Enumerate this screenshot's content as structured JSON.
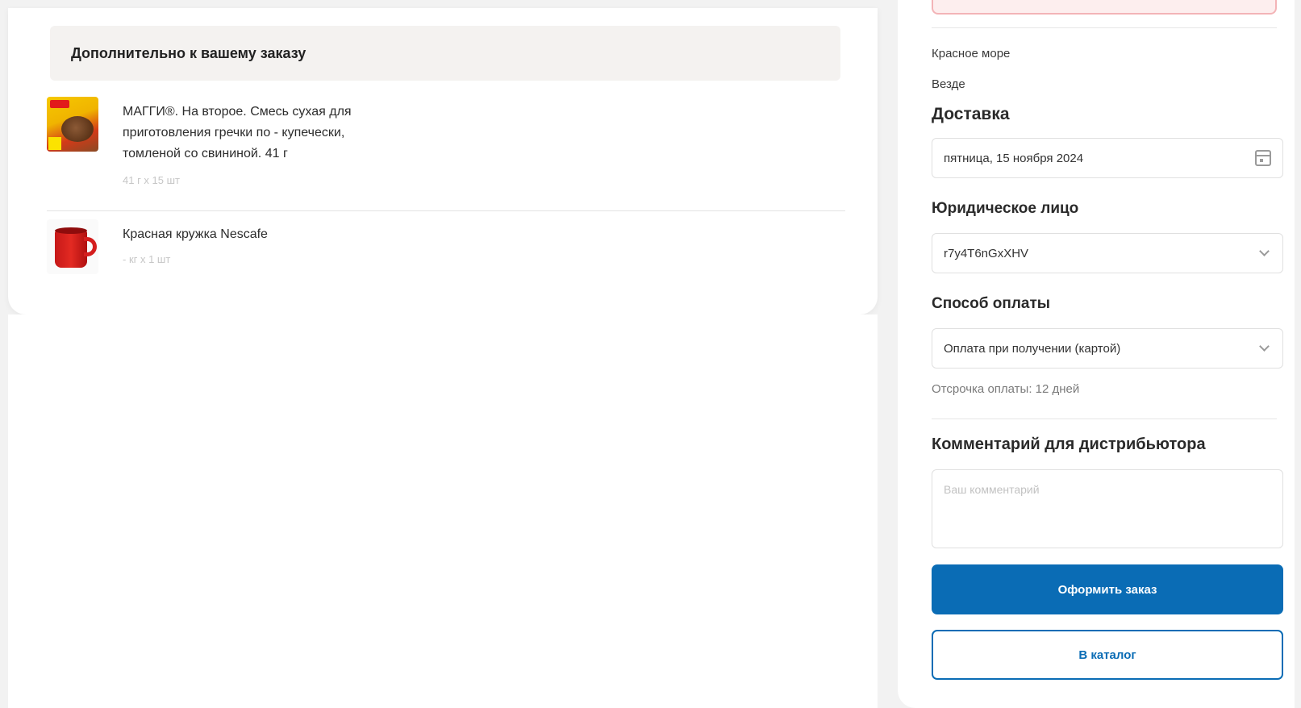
{
  "additions": {
    "header": "Дополнительно к вашему заказу",
    "items": [
      {
        "title": "МАГГИ®. На второе. Смесь сухая для приготовления гречки по - купечески, томленой со свининой. 41 г",
        "qty": "41 г x 15 шт",
        "image_icon": "maggi-package-image"
      },
      {
        "title": "Красная кружка Nescafe",
        "qty": "- кг x 1 шт",
        "image_icon": "red-mug-image"
      }
    ]
  },
  "checkout": {
    "line1": "Красное море",
    "line2": "Везде",
    "delivery": {
      "title": "Доставка",
      "date": "пятница, 15 ноября 2024",
      "icon": "calendar-icon"
    },
    "legal_entity": {
      "title": "Юридическое лицо",
      "value": "r7y4T6nGxXHV"
    },
    "payment": {
      "title": "Способ оплаты",
      "value": "Оплата при получении (картой)",
      "deferral": "Отсрочка оплаты: 12 дней"
    },
    "comment": {
      "title": "Комментарий для дистрибьютора",
      "placeholder": "Ваш комментарий"
    },
    "submit_label": "Оформить заказ",
    "catalog_label": "В каталог"
  },
  "colors": {
    "primary": "#0a6cb5",
    "warning_border": "#f3b4b7"
  }
}
